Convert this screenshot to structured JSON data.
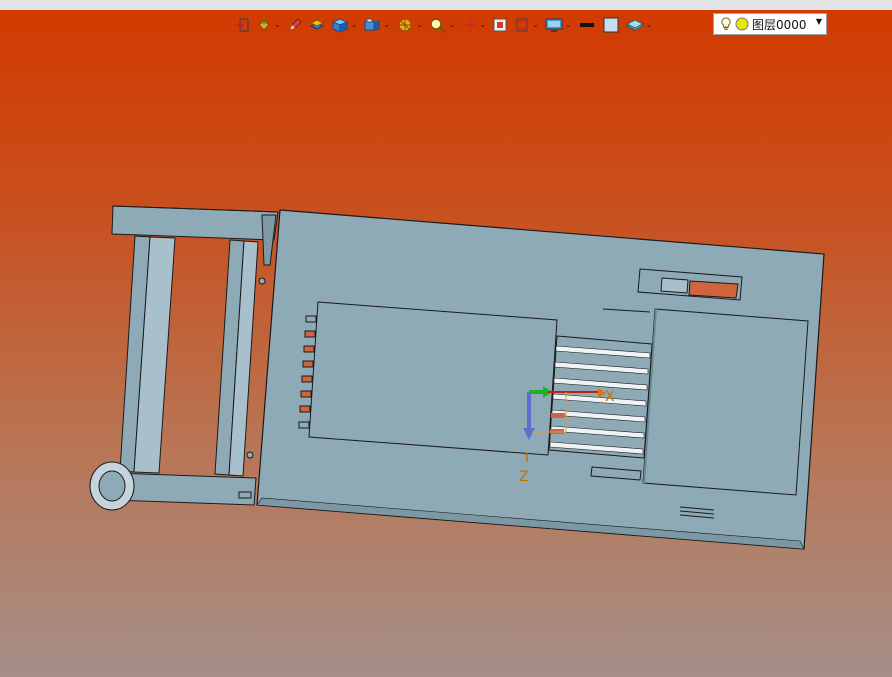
{
  "toolbar": {
    "layer_label": "图层0000",
    "tools": [
      {
        "name": "exit-sketch-icon"
      },
      {
        "name": "paint-bucket-icon",
        "dropdown": true
      },
      {
        "name": "pencil-icon"
      },
      {
        "name": "box-stack-icon"
      },
      {
        "name": "cube-icon",
        "dropdown": true
      },
      {
        "name": "view-cube-icon",
        "dropdown": true
      },
      {
        "name": "section-view-icon",
        "dropdown": true
      },
      {
        "name": "zoom-icon",
        "dropdown": true
      },
      {
        "name": "crosshair-icon",
        "dropdown": true
      },
      {
        "name": "select-frame-icon"
      },
      {
        "name": "align-icon",
        "dropdown": true
      },
      {
        "name": "monitor-display-icon",
        "dropdown": true
      },
      {
        "name": "line-color-icon"
      },
      {
        "name": "fill-color-icon"
      },
      {
        "name": "layer-stack-icon",
        "dropdown": true
      }
    ]
  },
  "colors": {
    "viewport_top": "#d23a00",
    "viewport_bottom": "#a58f88",
    "model_fill": "#8eaab7",
    "model_edge": "#1a1a1a",
    "accent_orange": "#d0643c"
  },
  "axes": {
    "x_label": "X",
    "z_label": "Z"
  }
}
